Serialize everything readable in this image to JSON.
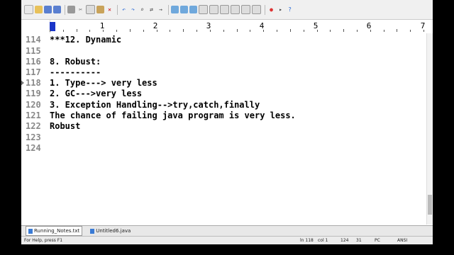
{
  "ruler": {
    "marks": [
      "1",
      "2",
      "3",
      "4",
      "5",
      "6",
      "7"
    ]
  },
  "editor": {
    "lines": [
      {
        "num": "114",
        "text": "***12. Dynamic"
      },
      {
        "num": "115",
        "text": ""
      },
      {
        "num": "116",
        "text": "8. Robust:"
      },
      {
        "num": "117",
        "text": "----------"
      },
      {
        "num": "118",
        "text": "1. Type---> very less"
      },
      {
        "num": "119",
        "text": "2. GC--->very less"
      },
      {
        "num": "120",
        "text": "3. Exception Handling-->try,catch,finally"
      },
      {
        "num": "121",
        "text": "The chance of failing java program is very less."
      },
      {
        "num": "122",
        "text": "Robust"
      },
      {
        "num": "123",
        "text": ""
      },
      {
        "num": "124",
        "text": ""
      }
    ]
  },
  "tabs": [
    {
      "label": "Running_Notes.txt"
    },
    {
      "label": "Untitled6.java"
    }
  ],
  "status": {
    "help": "For Help, press F1",
    "line": "ln 118",
    "col": "col 1",
    "num1": "124",
    "num2": "31",
    "mode": "PC",
    "encoding": "ANSI"
  }
}
